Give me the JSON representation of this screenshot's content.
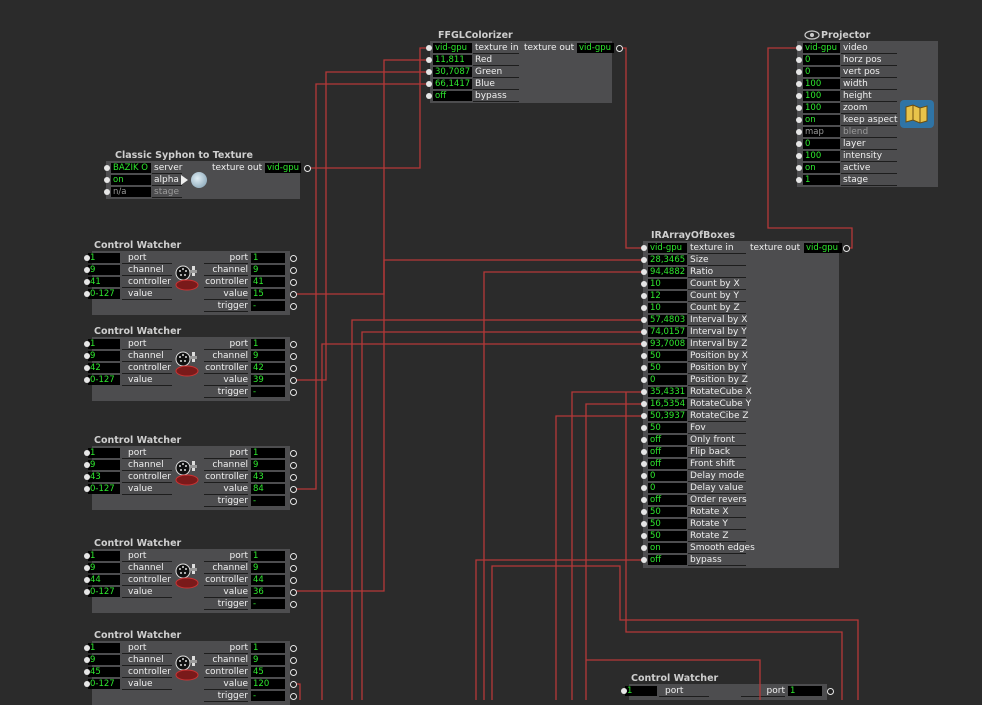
{
  "ffgl": {
    "title": "FFGLColorizer",
    "in": [
      {
        "value": "vid-gpu",
        "label": "texture in"
      },
      {
        "value": "11,811",
        "label": "Red"
      },
      {
        "value": "30,7087",
        "label": "Green"
      },
      {
        "value": "66,1417",
        "label": "Blue"
      },
      {
        "value": "off",
        "label": "bypass"
      }
    ],
    "out": {
      "label": "texture out",
      "value": "vid-gpu"
    }
  },
  "projector": {
    "title": "Projector",
    "icon": "eye-icon",
    "in": [
      {
        "value": "vid-gpu",
        "label": "video"
      },
      {
        "value": "0",
        "label": "horz pos"
      },
      {
        "value": "0",
        "label": "vert pos"
      },
      {
        "value": "100",
        "label": "width"
      },
      {
        "value": "100",
        "label": "height"
      },
      {
        "value": "100",
        "label": "zoom"
      },
      {
        "value": "on",
        "label": "keep aspect"
      },
      {
        "value": "map",
        "label": "blend",
        "dim": true
      },
      {
        "value": "0",
        "label": "layer"
      },
      {
        "value": "100",
        "label": "intensity"
      },
      {
        "value": "on",
        "label": "active"
      },
      {
        "value": "1",
        "label": "stage"
      }
    ]
  },
  "syphon": {
    "title": "Classic Syphon to Texture",
    "in": [
      {
        "value": "BAZIK O",
        "label": "server"
      },
      {
        "value": "on",
        "label": "alpha"
      },
      {
        "value": "n/a",
        "label": "stage",
        "dim": true
      }
    ],
    "out": {
      "label": "texture out",
      "value": "vid-gpu"
    }
  },
  "irarray": {
    "title": "IRArrayOfBoxes",
    "in": [
      {
        "value": "vid-gpu",
        "label": "texture in"
      },
      {
        "value": "28,3465",
        "label": "Size"
      },
      {
        "value": "94,4882",
        "label": "Ratio"
      },
      {
        "value": "10",
        "label": "Count by X"
      },
      {
        "value": "12",
        "label": "Count by Y"
      },
      {
        "value": "10",
        "label": "Count by Z"
      },
      {
        "value": "57,4803",
        "label": "Interval by X"
      },
      {
        "value": "74,0157",
        "label": "Interval by Y"
      },
      {
        "value": "93,7008",
        "label": "Interval by Z"
      },
      {
        "value": "50",
        "label": "Position by X"
      },
      {
        "value": "50",
        "label": "Position by Y"
      },
      {
        "value": "0",
        "label": "Position by Z"
      },
      {
        "value": "35,4331",
        "label": "RotateCube X"
      },
      {
        "value": "16,5354",
        "label": "RotateCube Y"
      },
      {
        "value": "50,3937",
        "label": "RotateCibe Z"
      },
      {
        "value": "50",
        "label": "Fov"
      },
      {
        "value": "off",
        "label": "Only front"
      },
      {
        "value": "off",
        "label": "Flip back"
      },
      {
        "value": "off",
        "label": "Front shift"
      },
      {
        "value": "0",
        "label": "Delay mode"
      },
      {
        "value": "0",
        "label": "Delay value"
      },
      {
        "value": "off",
        "label": "Order revers"
      },
      {
        "value": "50",
        "label": "Rotate X"
      },
      {
        "value": "50",
        "label": "Rotate Y"
      },
      {
        "value": "50",
        "label": "Rotate Z"
      },
      {
        "value": "on",
        "label": "Smooth edges"
      },
      {
        "value": "off",
        "label": "bypass"
      }
    ],
    "out": {
      "label": "texture out",
      "value": "vid-gpu"
    }
  },
  "watchers": [
    {
      "title": "Control Watcher",
      "in": [
        {
          "value": "1",
          "label": "port"
        },
        {
          "value": "9",
          "label": "channel"
        },
        {
          "value": "41",
          "label": "controller"
        },
        {
          "value": "0-127",
          "label": "value"
        }
      ],
      "out": [
        {
          "label": "port",
          "value": "1"
        },
        {
          "label": "channel",
          "value": "9"
        },
        {
          "label": "controller",
          "value": "41"
        },
        {
          "label": "value",
          "value": "15"
        },
        {
          "label": "trigger",
          "value": "-"
        }
      ]
    },
    {
      "title": "Control Watcher",
      "in": [
        {
          "value": "1",
          "label": "port"
        },
        {
          "value": "9",
          "label": "channel"
        },
        {
          "value": "42",
          "label": "controller"
        },
        {
          "value": "0-127",
          "label": "value"
        }
      ],
      "out": [
        {
          "label": "port",
          "value": "1"
        },
        {
          "label": "channel",
          "value": "9"
        },
        {
          "label": "controller",
          "value": "42"
        },
        {
          "label": "value",
          "value": "39"
        },
        {
          "label": "trigger",
          "value": "-"
        }
      ]
    },
    {
      "title": "Control Watcher",
      "in": [
        {
          "value": "1",
          "label": "port"
        },
        {
          "value": "9",
          "label": "channel"
        },
        {
          "value": "43",
          "label": "controller"
        },
        {
          "value": "0-127",
          "label": "value"
        }
      ],
      "out": [
        {
          "label": "port",
          "value": "1"
        },
        {
          "label": "channel",
          "value": "9"
        },
        {
          "label": "controller",
          "value": "43"
        },
        {
          "label": "value",
          "value": "84"
        },
        {
          "label": "trigger",
          "value": "-"
        }
      ]
    },
    {
      "title": "Control Watcher",
      "in": [
        {
          "value": "1",
          "label": "port"
        },
        {
          "value": "9",
          "label": "channel"
        },
        {
          "value": "44",
          "label": "controller"
        },
        {
          "value": "0-127",
          "label": "value"
        }
      ],
      "out": [
        {
          "label": "port",
          "value": "1"
        },
        {
          "label": "channel",
          "value": "9"
        },
        {
          "label": "controller",
          "value": "44"
        },
        {
          "label": "value",
          "value": "36"
        },
        {
          "label": "trigger",
          "value": "-"
        }
      ]
    },
    {
      "title": "Control Watcher",
      "in": [
        {
          "value": "1",
          "label": "port"
        },
        {
          "value": "9",
          "label": "channel"
        },
        {
          "value": "45",
          "label": "controller"
        },
        {
          "value": "0-127",
          "label": "value"
        }
      ],
      "out": [
        {
          "label": "port",
          "value": "1"
        },
        {
          "label": "channel",
          "value": "9"
        },
        {
          "label": "controller",
          "value": "45"
        },
        {
          "label": "value",
          "value": "120"
        },
        {
          "label": "trigger",
          "value": "-"
        }
      ]
    },
    {
      "title": "Control Watcher",
      "in": [
        {
          "value": "1",
          "label": "port"
        }
      ],
      "out": [
        {
          "label": "port",
          "value": "1"
        }
      ]
    }
  ],
  "colors": {
    "background": "#2b2b2b",
    "actor": "#4d4d4f",
    "wire": "#b83a3a",
    "value_text": "#2ee82e"
  }
}
